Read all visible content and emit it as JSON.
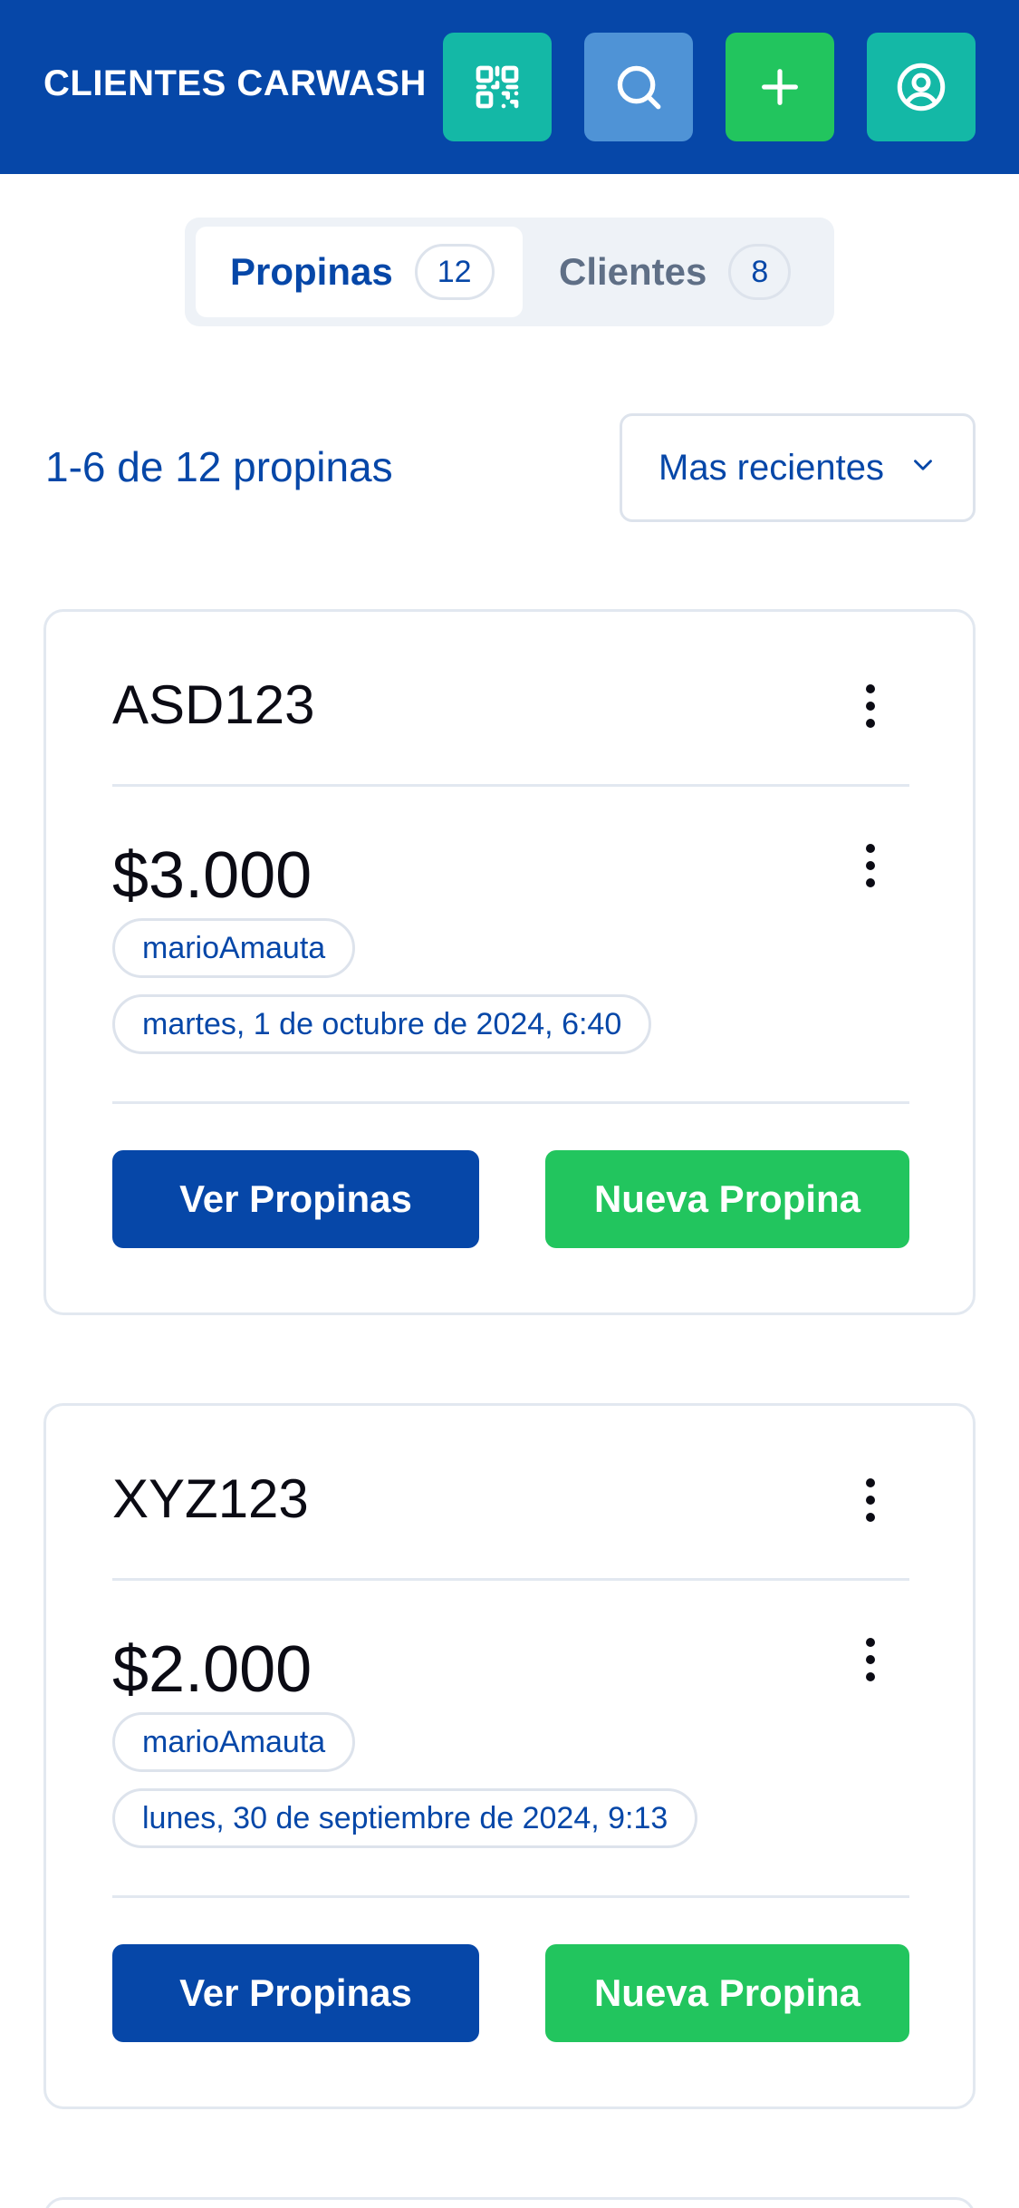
{
  "header": {
    "title": "CLIENTES CARWASH",
    "buttons": [
      {
        "icon": "qr-code-icon",
        "color": "#14b8a6"
      },
      {
        "icon": "search-icon",
        "color": "#4f93d6"
      },
      {
        "icon": "plus-icon",
        "color": "#22c55e"
      },
      {
        "icon": "user-circle-icon",
        "color": "#14b8a6"
      }
    ],
    "background": "#0647a8"
  },
  "tabs": [
    {
      "label": "Propinas",
      "count": "12",
      "active": true
    },
    {
      "label": "Clientes",
      "count": "8",
      "active": false
    }
  ],
  "list": {
    "range_text": "1-6 de 12 propinas",
    "sort_selected": "Mas recientes"
  },
  "cards": [
    {
      "plate": "ASD123",
      "amount": "$3.000",
      "user": "marioAmauta",
      "date": "martes, 1 de octubre de 2024, 6:40",
      "view_label": "Ver Propinas",
      "new_label": "Nueva Propina"
    },
    {
      "plate": "XYZ123",
      "amount": "$2.000",
      "user": "marioAmauta",
      "date": "lunes, 30 de septiembre de 2024, 9:13",
      "view_label": "Ver Propinas",
      "new_label": "Nueva Propina"
    }
  ],
  "colors": {
    "primary": "#0647a8",
    "success": "#22c55e",
    "teal": "#14b8a6",
    "border": "#e2e8f0"
  }
}
